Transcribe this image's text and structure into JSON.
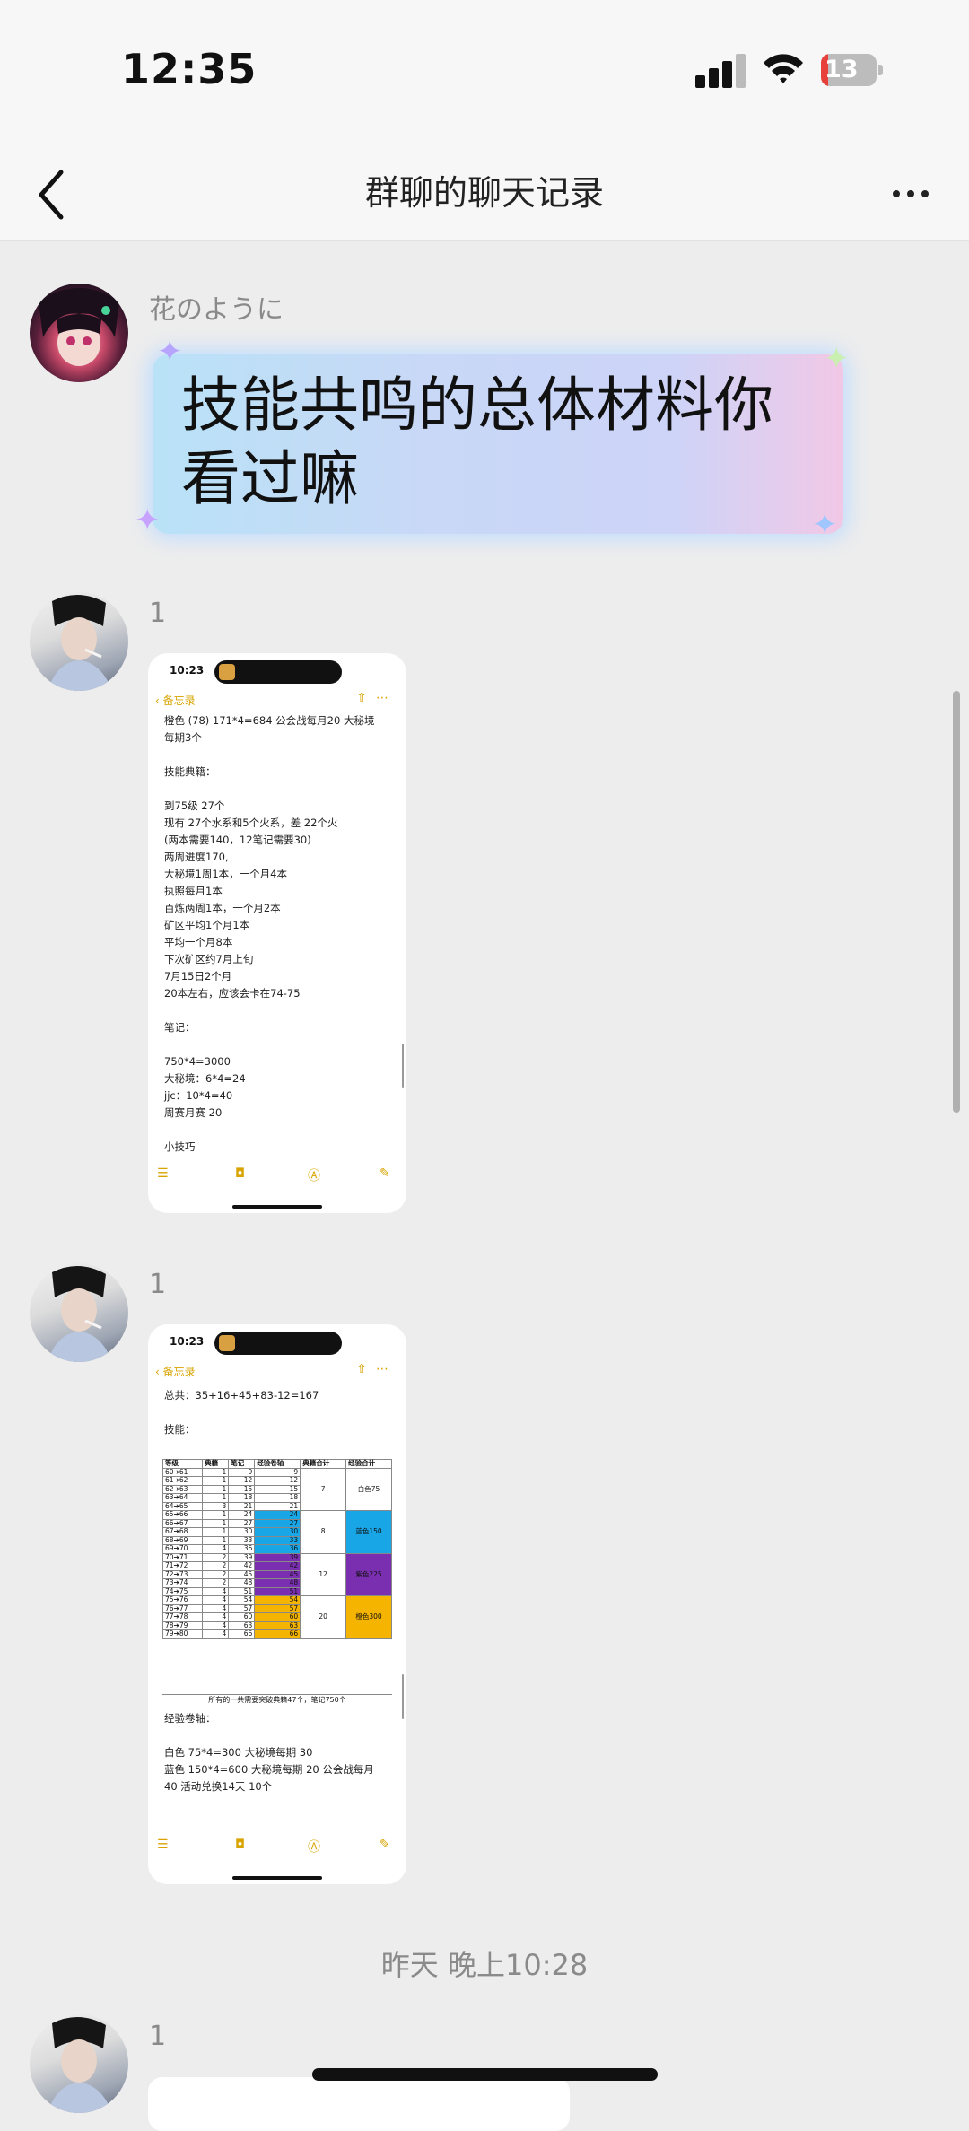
{
  "status_bar": {
    "time": "12:35",
    "battery": "13",
    "battery_level": 0.13
  },
  "nav": {
    "title": "群聊的聊天记录"
  },
  "messages": [
    {
      "sender": "花のように",
      "text": "技能共鸣的总体材料你看过嘛"
    },
    {
      "sender": "1"
    },
    {
      "sender": "1"
    },
    {
      "sender": "1"
    }
  ],
  "shot1": {
    "time": "10:23",
    "back_label": "备忘录",
    "lines": [
      "橙色 (78) 171*4=684 公会战每月20 大秘境",
      "每期3个",
      "",
      "技能典籍：",
      "",
      "到75级 27个",
      "现有 27个水系和5个火系，差 22个火",
      "(两本需要140，12笔记需要30)",
      "两周进度170,",
      "大秘境1周1本，一个月4本",
      "执照每月1本",
      "百炼两周1本，一个月2本",
      "矿区平均1个月1本",
      "平均一个月8本",
      "下次矿区约7月上旬",
      "7月15日2个月",
      "20本左右，应该会卡在74-75",
      "",
      "笔记：",
      "",
      "750*4=3000",
      "大秘境：6*4=24",
      "jjc：10*4=40",
      "周赛月赛 20",
      "",
      "小技巧"
    ]
  },
  "shot2": {
    "time": "10:23",
    "back_label": "备忘录",
    "total_line": "总共：35+16+45+83-12=167",
    "skill_label": "技能：",
    "table": {
      "headers": [
        "等级",
        "典籍",
        "笔记",
        "经验卷轴",
        "典籍合计",
        "经验合计"
      ],
      "rows": [
        [
          "60➔61",
          "1",
          "9",
          "9"
        ],
        [
          "61➔62",
          "1",
          "12",
          "12"
        ],
        [
          "62➔63",
          "1",
          "15",
          "15"
        ],
        [
          "63➔64",
          "1",
          "18",
          "18"
        ],
        [
          "64➔65",
          "3",
          "21",
          "21"
        ],
        [
          "65➔66",
          "1",
          "24",
          "24"
        ],
        [
          "66➔67",
          "1",
          "27",
          "27"
        ],
        [
          "67➔68",
          "1",
          "30",
          "30"
        ],
        [
          "68➔69",
          "1",
          "33",
          "33"
        ],
        [
          "69➔70",
          "4",
          "36",
          "36"
        ],
        [
          "70➔71",
          "2",
          "39",
          "39"
        ],
        [
          "71➔72",
          "2",
          "42",
          "42"
        ],
        [
          "72➔73",
          "2",
          "45",
          "45"
        ],
        [
          "73➔74",
          "2",
          "48",
          "48"
        ],
        [
          "74➔75",
          "4",
          "51",
          "51"
        ],
        [
          "75➔76",
          "4",
          "54",
          "54"
        ],
        [
          "76➔77",
          "4",
          "57",
          "57"
        ],
        [
          "77➔78",
          "4",
          "60",
          "60"
        ],
        [
          "78➔79",
          "4",
          "63",
          "63"
        ],
        [
          "79➔80",
          "4",
          "66",
          "66"
        ]
      ],
      "groups": [
        {
          "total": "7",
          "exp": "白色75",
          "color": "#ffffff"
        },
        {
          "total": "8",
          "exp": "蓝色150",
          "color": "#19a6e6"
        },
        {
          "total": "12",
          "exp": "紫色225",
          "color": "#7a2fb0"
        },
        {
          "total": "20",
          "exp": "橙色300",
          "color": "#f5b400"
        }
      ],
      "caption": "所有的一共需要突破典籍47个，笔记750个"
    },
    "after_lines": [
      "经验卷轴：",
      "",
      "白色 75*4=300 大秘境每期 30",
      "蓝色 150*4=600 大秘境每期 20 公会战每月",
      "40 活动兑换14天 10个"
    ]
  },
  "timestamp": "昨天 晚上10:28"
}
